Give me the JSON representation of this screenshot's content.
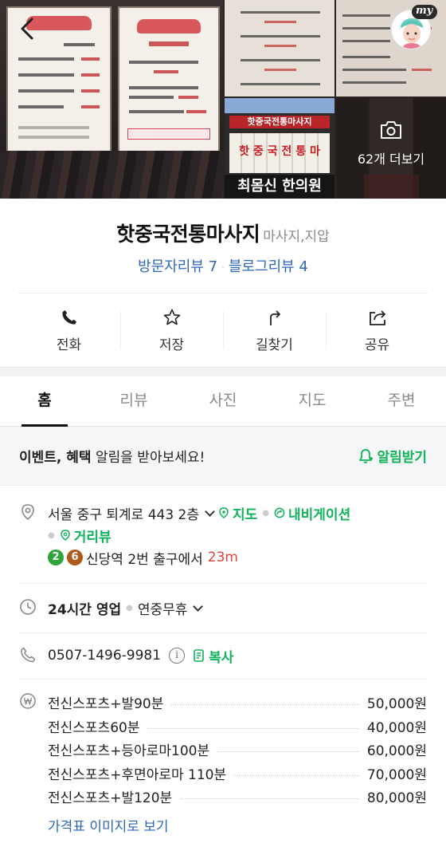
{
  "photos": {
    "more_label": "62개 더보기",
    "poster1_title": "핫중국전통마사지",
    "poster2_title": "핫중국전통마사지",
    "poster2_subtitle": "특별행사",
    "poster_lines_left": [
      "40분 발",
      "60분 발+다리아로마",
      "60분 후면 전신아로마",
      "90분 전신스포츠+발",
      "전신아로마"
    ],
    "poster_prices_left": [
      "4만원",
      "5만원",
      "5만원",
      "7만원"
    ],
    "poster_lines_right": [
      "100분 전신스포츠+등아로마",
      "110분 스포츠+등아로마 +다리아로마",
      "120분 전신아로마+발"
    ],
    "poster_prices_right": [
      "6만원",
      "7만원",
      "8만원"
    ],
    "poster_footer": "모든 코스 족욕 10분 포함입니다.",
    "sign_red": "핫중국전통마사지",
    "sign_strip": "핫 중 국 전 통 마",
    "sign_black": "최몸신 한의원",
    "avatar_badge": "my",
    "colors": {
      "accent_green": "#10b35a",
      "link_blue": "#2f66b6",
      "distance_red": "#e0443c"
    }
  },
  "header": {
    "name": "핫중국전통마사지",
    "category": "마사지,지압",
    "visitor_review": "방문자리뷰 7",
    "blog_review": "블로그리뷰 4"
  },
  "actions": [
    {
      "label": "전화",
      "icon": "phone-icon"
    },
    {
      "label": "저장",
      "icon": "star-icon"
    },
    {
      "label": "길찾기",
      "icon": "directions-icon"
    },
    {
      "label": "공유",
      "icon": "share-icon"
    }
  ],
  "tabs": [
    "홈",
    "리뷰",
    "사진",
    "지도",
    "주변"
  ],
  "notice": {
    "bold": "이벤트, 혜택",
    "rest": " 알림을 받아보세요!",
    "button": "알림받기"
  },
  "info": {
    "address": "서울 중구 퇴계로 443 2층",
    "map": "지도",
    "navigation": "내비게이션",
    "street_view": "거리뷰",
    "subway_lines": [
      {
        "num": "2",
        "color": "#2ea43a"
      },
      {
        "num": "6",
        "color": "#b05a1a"
      }
    ],
    "station": "신당역",
    "exit": "2번 출구에서",
    "distance": "23m",
    "hours_bold": "24시간 영업",
    "hours_extra": "연중무휴",
    "phone": "0507-1496-9981",
    "info_glyph": "i",
    "copy": "복사",
    "prices": [
      {
        "name": "전신스포츠+발90분",
        "price": "50,000원"
      },
      {
        "name": "전신스포츠60분",
        "price": "40,000원"
      },
      {
        "name": "전신스포츠+등아로마100분",
        "price": "60,000원"
      },
      {
        "name": "전신스포츠+후면아로마 110분",
        "price": "70,000원"
      },
      {
        "name": "전신스포츠+발120분",
        "price": "80,000원"
      }
    ],
    "price_link": "가격표 이미지로 보기"
  }
}
